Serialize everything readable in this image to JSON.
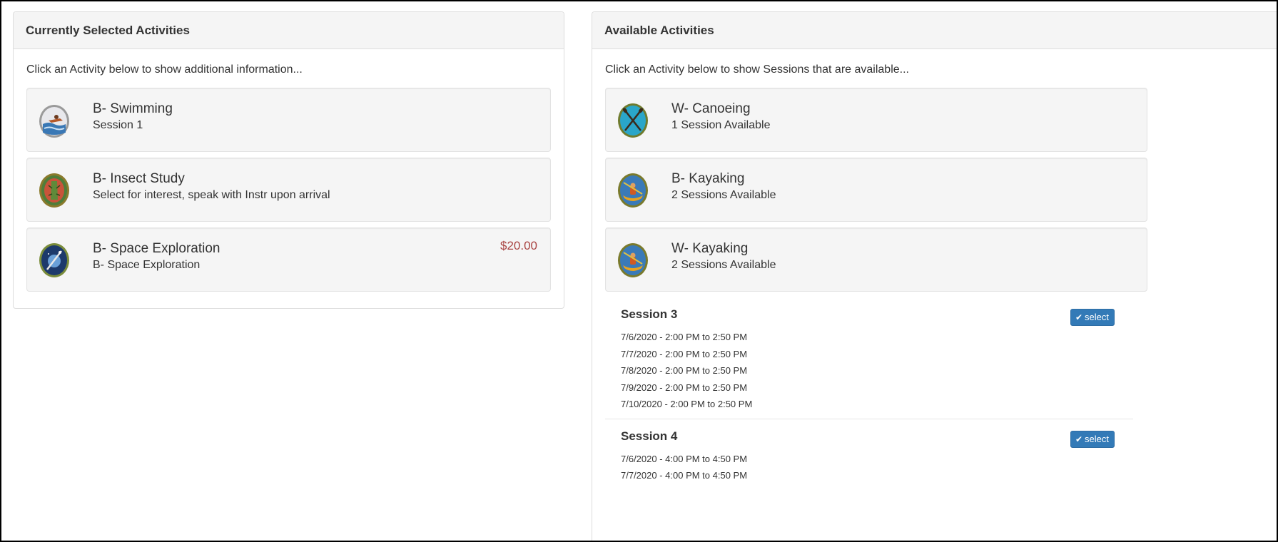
{
  "selected_panel": {
    "heading": "Currently Selected Activities",
    "hint": "Click an Activity below to show additional information...",
    "items": [
      {
        "title": "B- Swimming",
        "subtitle": "Session 1",
        "price": ""
      },
      {
        "title": "B- Insect Study",
        "subtitle": "Select for interest, speak with Instr upon arrival",
        "price": ""
      },
      {
        "title": "B- Space Exploration",
        "subtitle": "B- Space Exploration",
        "price": "$20.00"
      }
    ]
  },
  "available_panel": {
    "heading": "Available Activities",
    "hint": "Click an Activity below to show Sessions that are available...",
    "items": [
      {
        "title": "W- Canoeing",
        "subtitle": "1 Session Available"
      },
      {
        "title": "B- Kayaking",
        "subtitle": "2 Sessions Available"
      },
      {
        "title": "W- Kayaking",
        "subtitle": "2 Sessions Available"
      }
    ],
    "sessions": [
      {
        "title": "Session 3",
        "select_label": "select",
        "times": [
          "7/6/2020 - 2:00 PM to 2:50 PM",
          "7/7/2020 - 2:00 PM to 2:50 PM",
          "7/8/2020 - 2:00 PM to 2:50 PM",
          "7/9/2020 - 2:00 PM to 2:50 PM",
          "7/10/2020 - 2:00 PM to 2:50 PM"
        ]
      },
      {
        "title": "Session 4",
        "select_label": "select",
        "times": [
          "7/6/2020 - 4:00 PM to 4:50 PM",
          "7/7/2020 - 4:00 PM to 4:50 PM"
        ]
      }
    ]
  },
  "icons": {
    "swimming": "swimming-badge-icon",
    "insect": "insect-study-badge-icon",
    "space": "space-exploration-badge-icon",
    "canoe": "canoeing-badge-icon",
    "kayak": "kayaking-badge-icon",
    "check": "check-icon"
  },
  "colors": {
    "price": "#a94442",
    "button": "#337ab7",
    "panel_heading_bg": "#f5f5f5"
  }
}
